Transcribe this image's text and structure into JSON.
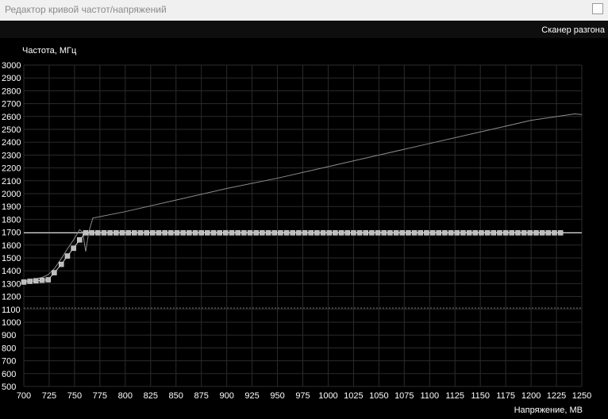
{
  "window": {
    "title": "Редактор кривой частот/напряжений"
  },
  "toolbar": {
    "scanner_label": "Сканер разгона"
  },
  "colors": {
    "background": "#000000",
    "grid": "#2b2b2b",
    "curve": "#8c8c8c",
    "points": "#d0d0d0",
    "hline": "#ffffff",
    "dotted": "#7a7a7a"
  },
  "chart_data": {
    "type": "line",
    "ylabel": "Частота, МГц",
    "xlabel": "Напряжение, МВ",
    "xlim": [
      700,
      1250
    ],
    "ylim": [
      500,
      3000
    ],
    "x_ticks": [
      700,
      725,
      750,
      775,
      800,
      825,
      850,
      875,
      900,
      925,
      950,
      975,
      1000,
      1025,
      1050,
      1075,
      1100,
      1125,
      1150,
      1175,
      1200,
      1225,
      1250
    ],
    "y_ticks": [
      500,
      600,
      700,
      800,
      900,
      1000,
      1100,
      1200,
      1300,
      1400,
      1500,
      1600,
      1700,
      1800,
      1900,
      2000,
      2100,
      2200,
      2300,
      2400,
      2500,
      2600,
      2700,
      2800,
      2900,
      3000
    ],
    "grid": true,
    "series": [
      {
        "values_x": [
          700,
          706,
          712,
          718,
          724,
          730,
          737,
          743,
          749,
          755,
          758,
          761,
          764,
          768,
          800,
          850,
          900,
          950,
          1000,
          1050,
          1100,
          1150,
          1200,
          1243,
          1250
        ],
        "values_y": [
          1320,
          1330,
          1338,
          1348,
          1370,
          1415,
          1495,
          1570,
          1640,
          1720,
          1700,
          1550,
          1700,
          1810,
          1860,
          1950,
          2040,
          2120,
          2210,
          2300,
          2390,
          2480,
          2570,
          2620,
          2615
        ]
      },
      {
        "values_x": [
          700,
          706,
          712,
          718,
          724,
          730,
          737,
          743,
          749,
          755,
          761,
          767,
          773,
          779,
          785,
          791,
          797,
          803,
          809,
          815,
          821,
          827,
          833,
          839,
          845,
          851,
          857,
          863,
          869,
          875,
          881,
          887,
          893,
          899,
          905,
          911,
          917,
          923,
          929,
          935,
          941,
          947,
          953,
          959,
          965,
          971,
          977,
          983,
          989,
          995,
          1001,
          1007,
          1013,
          1019,
          1025,
          1031,
          1037,
          1043,
          1049,
          1055,
          1061,
          1067,
          1073,
          1079,
          1085,
          1091,
          1097,
          1103,
          1109,
          1115,
          1121,
          1127,
          1133,
          1139,
          1145,
          1151,
          1157,
          1163,
          1169,
          1175,
          1181,
          1187,
          1193,
          1199,
          1205,
          1211,
          1217,
          1223,
          1229
        ],
        "values_y": [
          1312,
          1318,
          1322,
          1326,
          1330,
          1385,
          1450,
          1515,
          1575,
          1640,
          1695,
          1695,
          1695,
          1695,
          1695,
          1695,
          1695,
          1695,
          1695,
          1695,
          1695,
          1695,
          1695,
          1695,
          1695,
          1695,
          1695,
          1695,
          1695,
          1695,
          1695,
          1695,
          1695,
          1695,
          1695,
          1695,
          1695,
          1695,
          1695,
          1695,
          1695,
          1695,
          1695,
          1695,
          1695,
          1695,
          1695,
          1695,
          1695,
          1695,
          1695,
          1695,
          1695,
          1695,
          1695,
          1695,
          1695,
          1695,
          1695,
          1695,
          1695,
          1695,
          1695,
          1695,
          1695,
          1695,
          1695,
          1695,
          1695,
          1695,
          1695,
          1695,
          1695,
          1695,
          1695,
          1695,
          1695,
          1695,
          1695,
          1695,
          1695,
          1695,
          1695,
          1695,
          1695,
          1695,
          1695,
          1695,
          1695
        ]
      }
    ],
    "reference_line_y": 1695,
    "dotted_line_y": 1110
  }
}
